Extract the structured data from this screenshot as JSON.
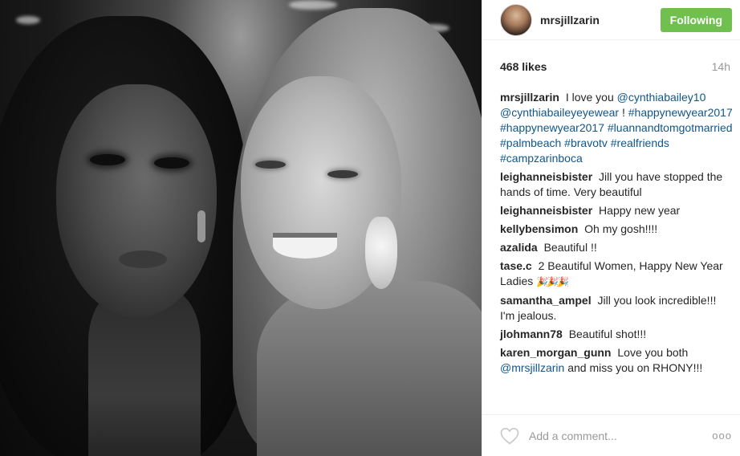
{
  "post": {
    "username": "mrsjillzarin",
    "follow_label": "Following",
    "likes": "468 likes",
    "time": "14h",
    "caption": {
      "author": "mrsjillzarin",
      "text_1": "I love you",
      "tags": [
        "@cynthiabailey10",
        "@cynthiabaileyeyewear",
        "#happynewyear2017",
        "#happynewyear2017",
        "#luannandtomgotmarried",
        "#palmbeach",
        "#bravotv",
        "#realfriends",
        "#campzarinboca"
      ],
      "text_2": "!"
    },
    "comments": [
      {
        "author": "leighanneisbister",
        "text": "Jill you have stopped the hands of time. Very beautiful"
      },
      {
        "author": "leighanneisbister",
        "text": "Happy new year"
      },
      {
        "author": "kellybensimon",
        "text": "Oh my gosh!!!!"
      },
      {
        "author": "azalida",
        "text": "Beautiful !!"
      },
      {
        "author": "tase.c",
        "text": "2 Beautiful Women, Happy New Year Ladies",
        "emoji": "🎉🎉🎉"
      },
      {
        "author": "samantha_ampel",
        "text": "Jill you look incredible!!! I'm jealous."
      },
      {
        "author": "jlohmann78",
        "text": "Beautiful shot!!!"
      },
      {
        "author": "karen_morgan_gunn",
        "text_1": "Love you both",
        "mention": "@mrsjillzarin",
        "text_2": "and miss you on RHONY!!!"
      }
    ],
    "add_comment_placeholder": "Add a comment...",
    "more_label": "ooo"
  },
  "colors": {
    "follow_button": "#70c050",
    "link": "#125688",
    "muted": "#999999",
    "text": "#262626"
  },
  "icons": {
    "heart": "heart-outline-icon",
    "more": "more-options-icon"
  }
}
